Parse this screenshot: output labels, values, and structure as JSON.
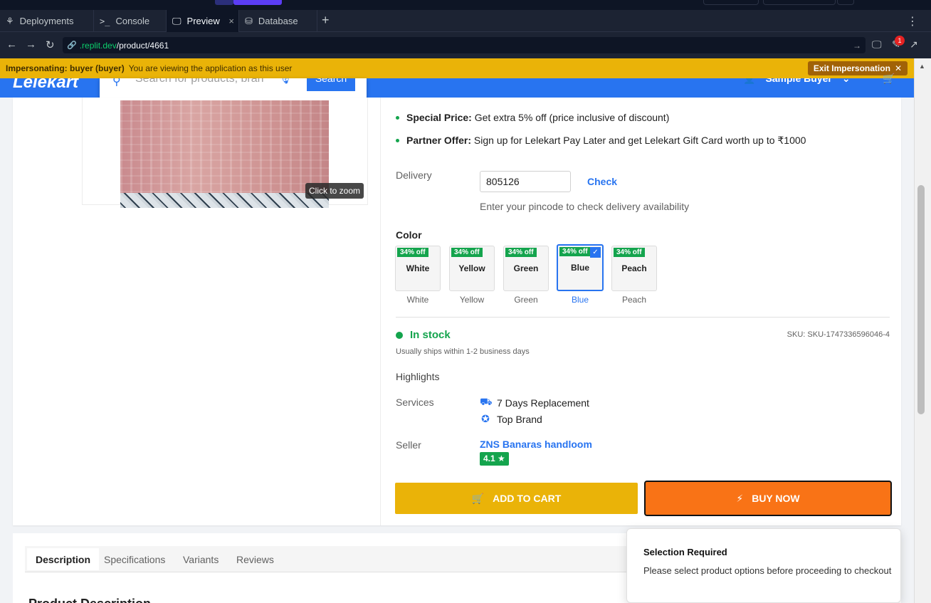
{
  "ide": {
    "tabs": [
      {
        "label": "Deployments",
        "icon": "deployments-icon"
      },
      {
        "label": "Console",
        "icon": "console-icon"
      },
      {
        "label": "Preview",
        "icon": "preview-icon"
      },
      {
        "label": "Database",
        "icon": "database-icon"
      }
    ],
    "close": "×",
    "plus": "+",
    "kebab": "⋮",
    "url_domain": ".replit.dev",
    "url_path": "/product/4661",
    "notif_count": "1"
  },
  "impersonation": {
    "bold": "Impersonating: buyer (buyer)",
    "text": "You are viewing the application as this user",
    "exit_label": "Exit Impersonation"
  },
  "header": {
    "logo": "Lelekart",
    "search_placeholder": "Search for products, brands and more",
    "search_button": "Search",
    "user": "Sample Buyer"
  },
  "product": {
    "zoom_hint": "Click to zoom",
    "offers": [
      {
        "bold": "Special Price:",
        "text": " Get extra 5% off (price inclusive of discount)"
      },
      {
        "bold": "Partner Offer:",
        "text": " Sign up for Lelekart Pay Later and get Lelekart Gift Card worth up to ₹1000"
      }
    ],
    "delivery_label": "Delivery",
    "pincode": "805126",
    "check_label": "Check",
    "pincode_help": "Enter your pincode to check delivery availability",
    "color_label": "Color",
    "colors": [
      {
        "name": "White",
        "badge": "34% off"
      },
      {
        "name": "Yellow",
        "badge": "34% off"
      },
      {
        "name": "Green",
        "badge": "34% off"
      },
      {
        "name": "Blue",
        "badge": "34% off"
      },
      {
        "name": "Peach",
        "badge": "34% off"
      }
    ],
    "selected_color": "Blue",
    "stock": "In stock",
    "ships": "Usually ships within 1-2 business days",
    "sku": "SKU: SKU-1747336596046-4",
    "highlights_label": "Highlights",
    "services_label": "Services",
    "services": [
      "7 Days Replacement",
      "Top Brand"
    ],
    "seller_label": "Seller",
    "seller_name": "ZNS Banaras handloom",
    "seller_rating": "4.1",
    "add_to_cart": "ADD TO CART",
    "buy_now": "BUY NOW"
  },
  "details": {
    "tabs": [
      "Description",
      "Specifications",
      "Variants",
      "Reviews"
    ],
    "heading": "Product Description"
  },
  "toast": {
    "title": "Selection Required",
    "message": "Please select product options before proceeding to checkout"
  },
  "colors": {
    "brand_blue": "#2874f0",
    "banner_yellow": "#eab308",
    "buy_orange": "#f97316",
    "success_green": "#14a44d"
  }
}
